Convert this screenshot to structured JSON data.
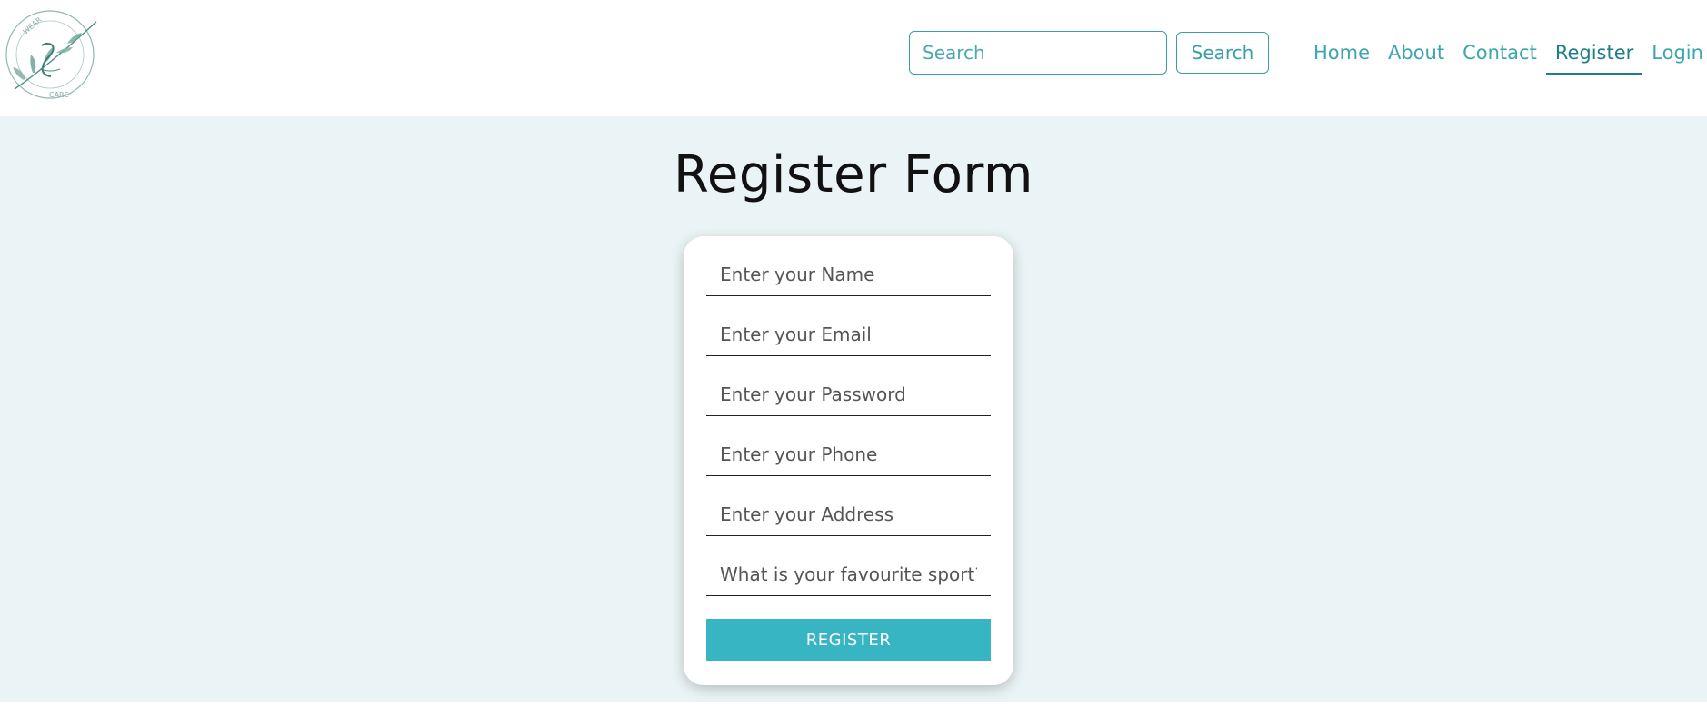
{
  "logo": {
    "top_text": "WEAR",
    "bottom_text": "CARE"
  },
  "search": {
    "placeholder": "Search",
    "button_label": "Search"
  },
  "nav": {
    "items": [
      {
        "label": "Home"
      },
      {
        "label": "About"
      },
      {
        "label": "Contact"
      },
      {
        "label": "Register",
        "active": true
      },
      {
        "label": "Login"
      }
    ]
  },
  "page": {
    "title": "Register Form"
  },
  "form": {
    "fields": [
      {
        "placeholder": "Enter your Name",
        "value": ""
      },
      {
        "placeholder": "Enter your Email",
        "value": ""
      },
      {
        "placeholder": "Enter your Password",
        "value": ""
      },
      {
        "placeholder": "Enter your Phone",
        "value": ""
      },
      {
        "placeholder": "Enter your Address",
        "value": ""
      },
      {
        "placeholder": "What is your favourite sport?",
        "value": ""
      }
    ],
    "submit_label": "REGISTER"
  },
  "colors": {
    "accent": "#3ba6ad",
    "accent_dark": "#1f7f88",
    "button_bg": "#37b5c2",
    "main_bg": "#eaf3f5"
  }
}
